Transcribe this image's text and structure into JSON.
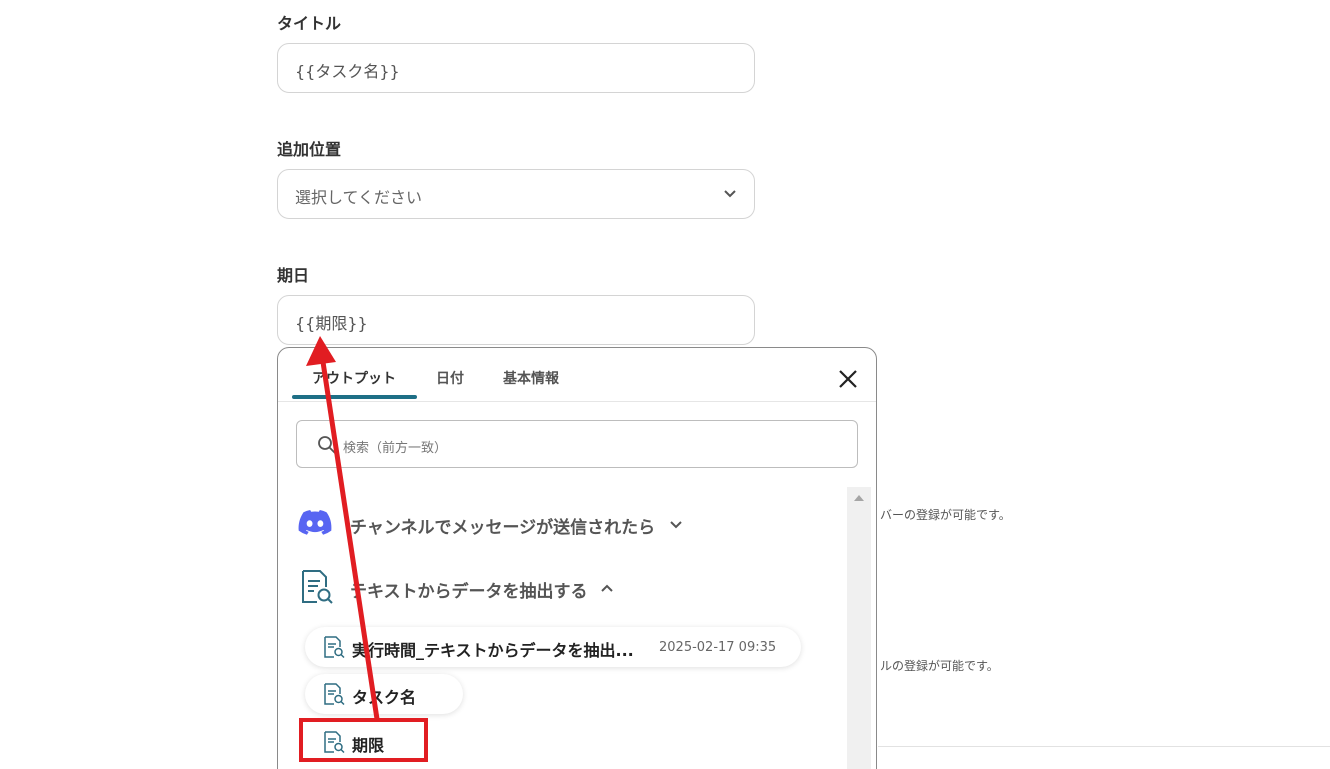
{
  "form": {
    "title_field": {
      "label": "タイトル",
      "value": "{{タスク名}}"
    },
    "position_field": {
      "label": "追加位置",
      "placeholder": "選択してください"
    },
    "due_field": {
      "label": "期日",
      "value": "{{期限}}"
    }
  },
  "background_notes": {
    "note1": "バーの登録が可能です。",
    "note2": "ルの登録が可能です。"
  },
  "popup": {
    "tabs": [
      {
        "label": "アウトプット",
        "active": true
      },
      {
        "label": "日付",
        "active": false
      },
      {
        "label": "基本情報",
        "active": false
      }
    ],
    "search_placeholder": "検索（前方一致）",
    "groups": [
      {
        "label": "チャンネルでメッセージが送信されたら",
        "icon": "discord-icon",
        "expanded": false
      },
      {
        "label": "テキストからデータを抽出する",
        "icon": "document-search-icon",
        "expanded": true
      }
    ],
    "items": [
      {
        "label": "実行時間_テキストからデータを抽出...",
        "meta": "2025-02-17 09:35"
      },
      {
        "label": "タスク名",
        "meta": ""
      },
      {
        "label": "期限",
        "meta": ""
      }
    ]
  },
  "colors": {
    "tab_active": "#1e6f86",
    "discord": "#5865f2",
    "annotation": "#e11d22"
  }
}
